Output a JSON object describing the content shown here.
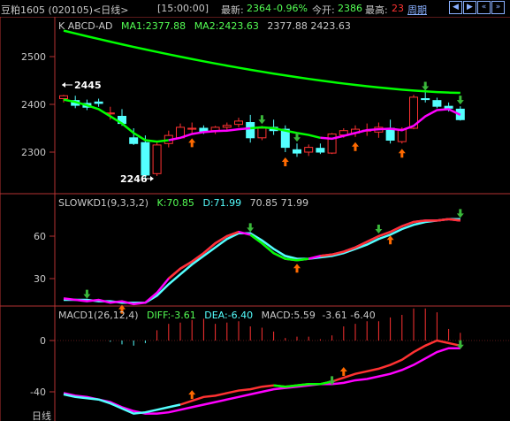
{
  "header": {
    "title": "豆粕1605 (020105)<日线>",
    "time": "[15:00:00]",
    "latest_label": "最新:",
    "latest_value": "2364",
    "change": "-0.96%",
    "open_label": "今开:",
    "open_value": "2386",
    "high_label": "最高:",
    "high_value": "23",
    "period_link": "周期",
    "nav_icons": [
      "arrow-left-icon",
      "arrow-right-icon",
      "double-left-icon",
      "double-right-icon",
      "square-icon",
      "close-icon"
    ]
  },
  "panel_main": {
    "indicator": "K  ABCD-AD",
    "ma1": "MA1:2377.88",
    "ma2": "MA2:2423.63",
    "ma_values": "2377.88  2423.63",
    "yticks": [
      "2500",
      "2400",
      "2300"
    ],
    "high_marker": "2445",
    "low_marker": "2246"
  },
  "panel_kd": {
    "indicator": "SLOWKD1(9,3,3,2)",
    "k": "K:70.85",
    "d": "D:71.99",
    "values": "70.85  71.99",
    "yticks": [
      "60",
      "30"
    ]
  },
  "panel_macd": {
    "indicator": "MACD1(26,12,4)",
    "diff": "DIFF:-3.61",
    "dea": "DEA:-6.40",
    "macd": "MACD:5.59",
    "values": "-3.61  -6.40",
    "yticks": [
      "0",
      "-40"
    ],
    "bottom_label": "日线"
  },
  "colors": {
    "background": "#000000",
    "up": "#ff3232",
    "down": "#54ffff",
    "ma1": "#00ff00",
    "ma2": "#00ff00",
    "axis": "#b43232",
    "link": "#8ab0ff",
    "kline": "#ff3232",
    "dline": "#ff00ff",
    "green_seg": "#00ff00",
    "cyan_seg": "#54ffff",
    "signal_buy": "#ff6a00",
    "signal_sell": "#3ab83a"
  },
  "chart_data": {
    "type": "candlestick",
    "candles": [
      {
        "o": 2412,
        "h": 2420,
        "l": 2404,
        "c": 2418
      },
      {
        "o": 2408,
        "h": 2418,
        "l": 2392,
        "c": 2398
      },
      {
        "o": 2402,
        "h": 2410,
        "l": 2388,
        "c": 2394
      },
      {
        "o": 2405,
        "h": 2412,
        "l": 2395,
        "c": 2402
      },
      {
        "o": 2380,
        "h": 2395,
        "l": 2368,
        "c": 2382
      },
      {
        "o": 2375,
        "h": 2390,
        "l": 2355,
        "c": 2360
      },
      {
        "o": 2330,
        "h": 2350,
        "l": 2315,
        "c": 2318
      },
      {
        "o": 2320,
        "h": 2335,
        "l": 2246,
        "c": 2252
      },
      {
        "o": 2255,
        "h": 2320,
        "l": 2250,
        "c": 2315
      },
      {
        "o": 2318,
        "h": 2345,
        "l": 2310,
        "c": 2335
      },
      {
        "o": 2330,
        "h": 2360,
        "l": 2328,
        "c": 2352
      },
      {
        "o": 2348,
        "h": 2362,
        "l": 2340,
        "c": 2350
      },
      {
        "o": 2350,
        "h": 2356,
        "l": 2338,
        "c": 2342
      },
      {
        "o": 2345,
        "h": 2355,
        "l": 2338,
        "c": 2352
      },
      {
        "o": 2352,
        "h": 2362,
        "l": 2346,
        "c": 2356
      },
      {
        "o": 2358,
        "h": 2372,
        "l": 2352,
        "c": 2365
      },
      {
        "o": 2362,
        "h": 2378,
        "l": 2320,
        "c": 2330
      },
      {
        "o": 2330,
        "h": 2355,
        "l": 2325,
        "c": 2350
      },
      {
        "o": 2352,
        "h": 2368,
        "l": 2336,
        "c": 2345
      },
      {
        "o": 2348,
        "h": 2356,
        "l": 2300,
        "c": 2310
      },
      {
        "o": 2305,
        "h": 2318,
        "l": 2290,
        "c": 2298
      },
      {
        "o": 2300,
        "h": 2316,
        "l": 2292,
        "c": 2310
      },
      {
        "o": 2308,
        "h": 2318,
        "l": 2296,
        "c": 2300
      },
      {
        "o": 2298,
        "h": 2340,
        "l": 2296,
        "c": 2338
      },
      {
        "o": 2336,
        "h": 2350,
        "l": 2330,
        "c": 2345
      },
      {
        "o": 2340,
        "h": 2356,
        "l": 2332,
        "c": 2348
      },
      {
        "o": 2344,
        "h": 2360,
        "l": 2334,
        "c": 2346
      },
      {
        "o": 2342,
        "h": 2362,
        "l": 2330,
        "c": 2352
      },
      {
        "o": 2350,
        "h": 2368,
        "l": 2318,
        "c": 2325
      },
      {
        "o": 2322,
        "h": 2352,
        "l": 2318,
        "c": 2348
      },
      {
        "o": 2350,
        "h": 2420,
        "l": 2348,
        "c": 2415
      },
      {
        "o": 2412,
        "h": 2425,
        "l": 2404,
        "c": 2410
      },
      {
        "o": 2408,
        "h": 2414,
        "l": 2392,
        "c": 2396
      },
      {
        "o": 2396,
        "h": 2404,
        "l": 2385,
        "c": 2392
      },
      {
        "o": 2390,
        "h": 2396,
        "l": 2366,
        "c": 2368
      }
    ],
    "ma1": [
      2410,
      2405,
      2398,
      2390,
      2375,
      2360,
      2340,
      2325,
      2322,
      2325,
      2330,
      2338,
      2342,
      2344,
      2345,
      2348,
      2350,
      2352,
      2350,
      2345,
      2340,
      2336,
      2330,
      2328,
      2334,
      2340,
      2346,
      2348,
      2349,
      2346,
      2355,
      2375,
      2388,
      2390,
      2378
    ],
    "ma2_start": 2560,
    "ma2_end": 2424,
    "kd_k": [
      16,
      15,
      14,
      15,
      13,
      14,
      12,
      13,
      20,
      30,
      37,
      42,
      48,
      55,
      60,
      63,
      61,
      55,
      48,
      44,
      43,
      44,
      46,
      47,
      49,
      52,
      56,
      60,
      63,
      67,
      70,
      71,
      71,
      72,
      71
    ],
    "kd_d": [
      15,
      15,
      15,
      14,
      14,
      13,
      13,
      13,
      18,
      26,
      33,
      40,
      46,
      52,
      58,
      62,
      62,
      57,
      51,
      46,
      44,
      44,
      45,
      46,
      48,
      51,
      54,
      58,
      61,
      65,
      68,
      70,
      71,
      72,
      72
    ],
    "macd_diff": [
      -42,
      -44,
      -45,
      -46,
      -49,
      -53,
      -57,
      -56,
      -54,
      -52,
      -50,
      -47,
      -44,
      -43,
      -41,
      -39,
      -38,
      -36,
      -35,
      -36,
      -35,
      -34,
      -34,
      -32,
      -29,
      -26,
      -24,
      -22,
      -19,
      -15,
      -9,
      -4,
      0,
      -2,
      -4
    ],
    "macd_dea": [
      -41,
      -43,
      -44,
      -46,
      -48,
      -52,
      -55,
      -57,
      -57,
      -56,
      -54,
      -52,
      -50,
      -48,
      -46,
      -44,
      -42,
      -40,
      -38,
      -37,
      -36,
      -35,
      -34,
      -34,
      -33,
      -31,
      -30,
      -28,
      -26,
      -23,
      -19,
      -14,
      -9,
      -6,
      -6
    ],
    "macd_hist": [
      0,
      0,
      0,
      0,
      -1,
      -3,
      -4,
      -2,
      8,
      13,
      14,
      16,
      17,
      13,
      14,
      15,
      11,
      10,
      7,
      2,
      3,
      3,
      1,
      4,
      11,
      13,
      15,
      15,
      18,
      20,
      25,
      25,
      22,
      9,
      6
    ],
    "main_ylim": [
      2200,
      2540
    ],
    "kd_ylim": [
      0,
      85
    ],
    "macd_ylim": [
      -60,
      20
    ]
  }
}
